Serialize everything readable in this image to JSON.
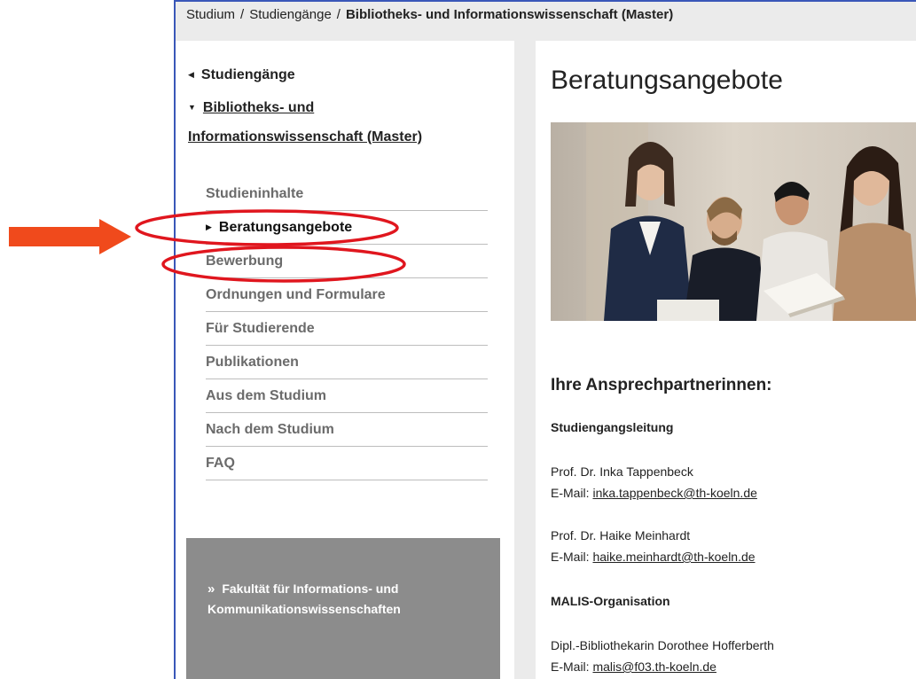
{
  "breadcrumb": {
    "items": [
      "Studium",
      "Studiengänge"
    ],
    "separator": "/",
    "current": "Bibliotheks- und Informationswissenschaft (Master)"
  },
  "sidebar": {
    "back_label": "Studiengänge",
    "parent_label": "Bibliotheks- und Informationswissenschaft (Master)",
    "items": [
      {
        "label": "Studieninhalte",
        "active": false
      },
      {
        "label": "Beratungsangebote",
        "active": true
      },
      {
        "label": "Bewerbung",
        "active": false
      },
      {
        "label": "Ordnungen und Formulare",
        "active": false
      },
      {
        "label": "Für Studierende",
        "active": false
      },
      {
        "label": "Publikationen",
        "active": false
      },
      {
        "label": "Aus dem Studium",
        "active": false
      },
      {
        "label": "Nach dem Studium",
        "active": false
      },
      {
        "label": "FAQ",
        "active": false
      }
    ],
    "promo": {
      "chevron": "»",
      "text": "Fakultät für Informations- und Kommunikationswissenschaften"
    }
  },
  "content": {
    "title": "Beratungsangebote",
    "contacts_heading": "Ihre Ansprechpartnerinnen:",
    "sections": [
      {
        "title": "Studiengangsleitung",
        "people": [
          {
            "name": "Prof. Dr. Inka Tappenbeck",
            "email_label": "E-Mail:",
            "email": "inka.tappenbeck@th-koeln.de"
          },
          {
            "name": "Prof. Dr. Haike Meinhardt",
            "email_label": "E-Mail:",
            "email": "haike.meinhardt@th-koeln.de"
          }
        ]
      },
      {
        "title": "MALIS-Organisation",
        "people": [
          {
            "name": "Dipl.-Bibliothekarin Dorothee Hofferberth",
            "email_label": "E-Mail:",
            "email": "malis@f03.th-koeln.de"
          }
        ]
      }
    ]
  },
  "annotations": {
    "arrow_color": "#f04a1c",
    "ellipse_color": "#e0161e"
  }
}
